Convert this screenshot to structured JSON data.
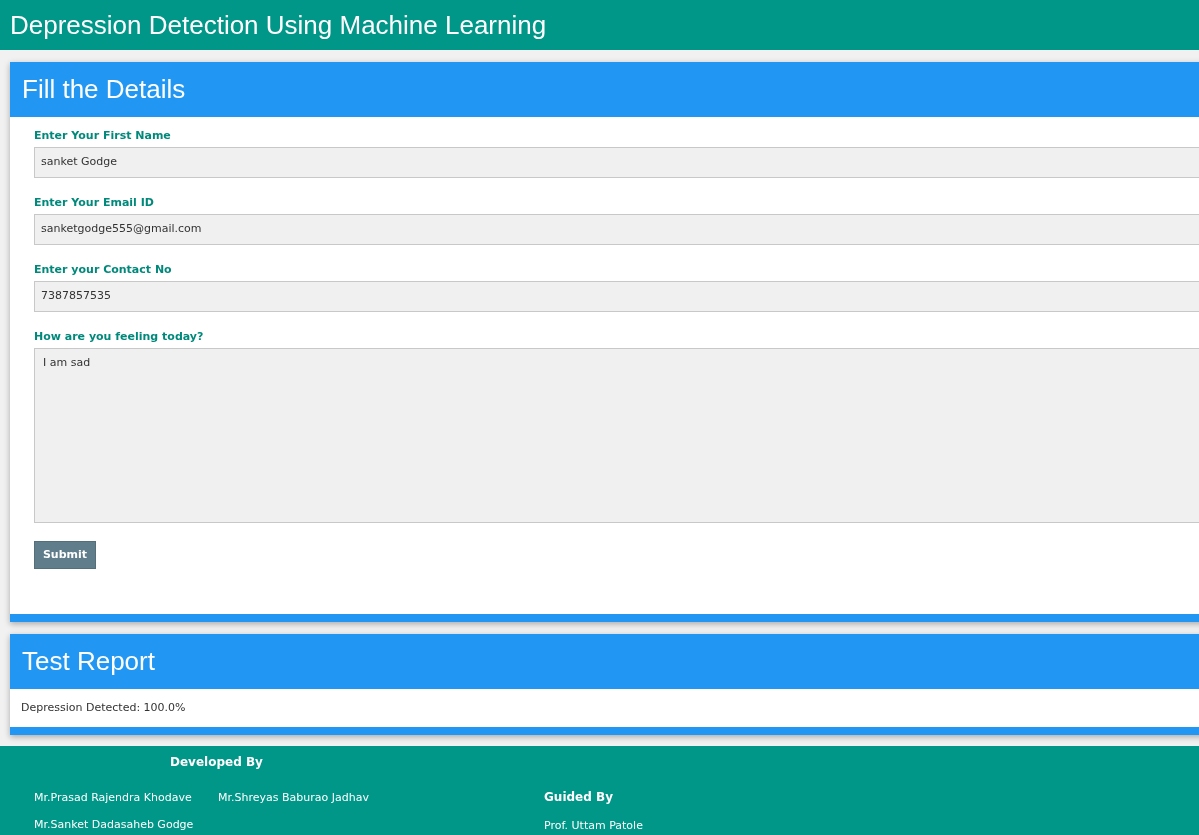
{
  "header": {
    "title": "Depression Detection Using Machine Learning"
  },
  "form_card": {
    "title": "Fill the Details",
    "fields": [
      {
        "kind": "input",
        "label": "Enter Your First Name",
        "value": "sanket Godge"
      },
      {
        "kind": "input",
        "label": "Enter Your Email ID",
        "value": "sanketgodge555@gmail.com"
      },
      {
        "kind": "input",
        "label": "Enter your Contact No",
        "value": "7387857535"
      },
      {
        "kind": "textarea",
        "label": "How are you feeling today?",
        "value": "I am sad"
      }
    ],
    "submit_button": "Submit"
  },
  "report_card": {
    "title": "Test Report",
    "result": "Depression Detected: 100.0%"
  },
  "footer": {
    "developed_by": {
      "heading": "Developed By",
      "names": [
        "Mr.Prasad Rajendra Khodave",
        "Mr.Shreyas Baburao Jadhav",
        "Mr.Sanket Dadasaheb Godge"
      ]
    },
    "guided_by": {
      "heading": "Guided By",
      "names": [
        "Prof. Uttam Patole"
      ]
    }
  }
}
